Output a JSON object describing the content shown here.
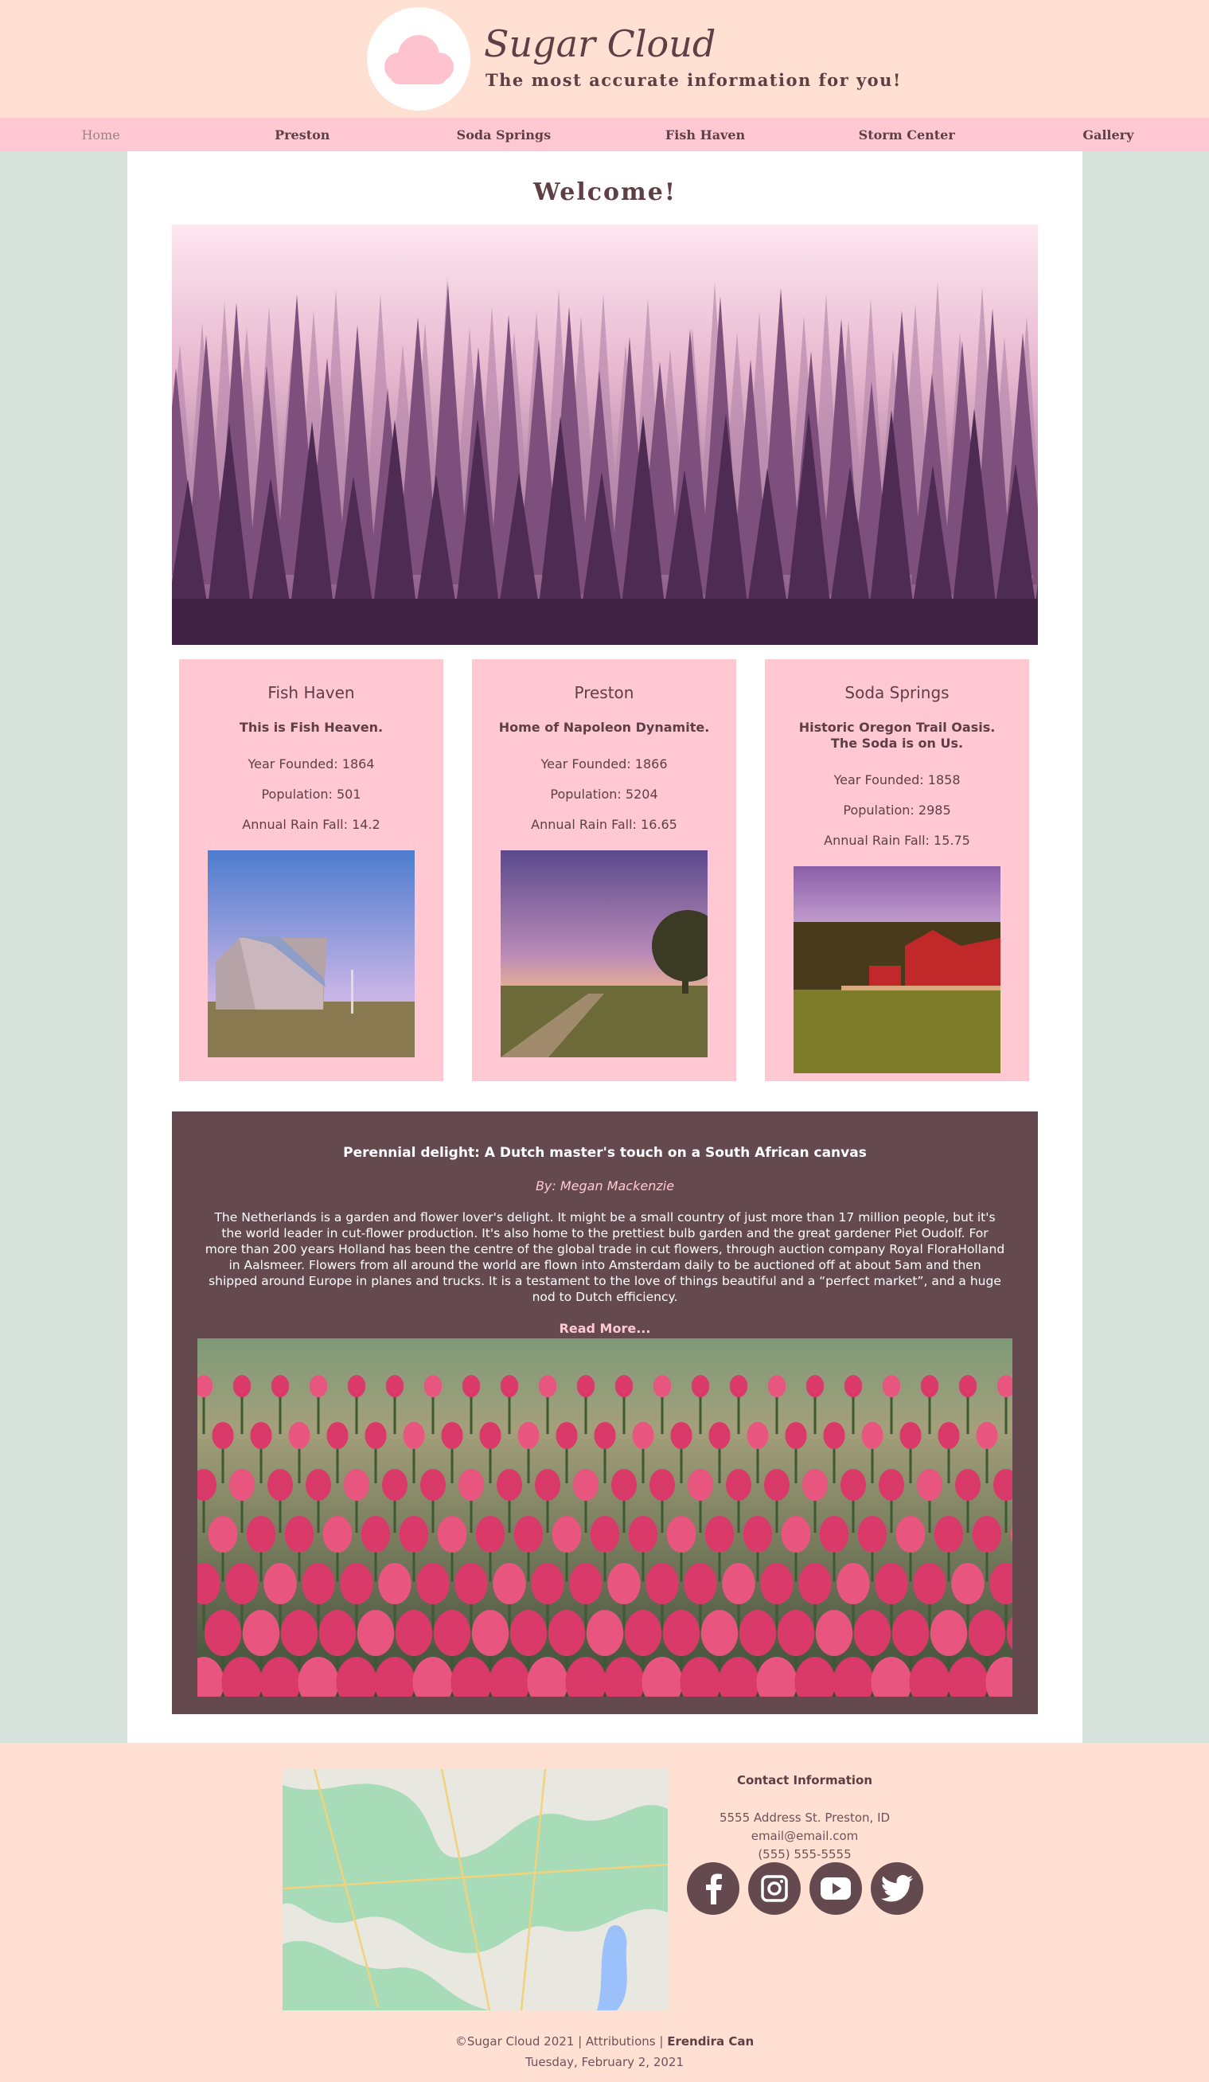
{
  "header": {
    "site_title": "Sugar Cloud",
    "tagline": "The most accurate information for you!",
    "logo_icon": "cloud-icon"
  },
  "nav": {
    "items": [
      {
        "label": "Home",
        "active": true
      },
      {
        "label": "Preston",
        "active": false
      },
      {
        "label": "Soda Springs",
        "active": false
      },
      {
        "label": "Fish Haven",
        "active": false
      },
      {
        "label": "Storm Center",
        "active": false
      },
      {
        "label": "Gallery",
        "active": false
      }
    ]
  },
  "main": {
    "heading": "Welcome!",
    "towns": [
      {
        "name": "Fish Haven",
        "motto": "This is Fish Heaven.",
        "year_founded": "Year Founded: 1864",
        "population": "Population: 501",
        "rainfall": "Annual Rain Fall: 14.2"
      },
      {
        "name": "Preston",
        "motto": "Home of Napoleon Dynamite.",
        "year_founded": "Year Founded: 1866",
        "population": "Population: 5204",
        "rainfall": "Annual Rain Fall: 16.65"
      },
      {
        "name": "Soda Springs",
        "motto": "Historic Oregon Trail Oasis. The Soda is on Us.",
        "year_founded": "Year Founded: 1858",
        "population": "Population: 2985",
        "rainfall": "Annual Rain Fall: 15.75"
      }
    ],
    "article": {
      "title": "Perennial delight: A Dutch master's touch on a South African canvas",
      "author": "By: Megan Mackenzie",
      "body": "The Netherlands is a garden and flower lover's delight. It might be a small country of just more than 17 million people, but it's the world leader in cut-flower production. It's also home to the prettiest bulb garden and the great gardener Piet Oudolf. For more than 200 years Holland has been the centre of the global trade in cut flowers, through auction company Royal FloraHolland in Aalsmeer. Flowers from all around the world are flown into Amsterdam daily to be auctioned off at about 5am and then shipped around Europe in planes and trucks. It is a testament to the love of things beautiful and a “perfect market”, and a huge nod to Dutch efficiency.",
      "read_more": "Read More..."
    }
  },
  "footer": {
    "contact_heading": "Contact Information",
    "address": "5555 Address St. Preston, ID",
    "email": "email@email.com",
    "phone": "(555) 555-5555",
    "social_icons": [
      "facebook-icon",
      "instagram-icon",
      "youtube-icon",
      "twitter-icon"
    ],
    "copyright_prefix": "©Sugar Cloud 2021 | Attributions |",
    "author": "Erendira Can",
    "date": "Tuesday, February 2, 2021"
  },
  "colors": {
    "header_bg": "#ffe0d3",
    "nav_bg": "#ffc8d2",
    "page_bg": "#d7e2dc",
    "text": "#5d3f45",
    "article_bg": "#644a4f"
  }
}
